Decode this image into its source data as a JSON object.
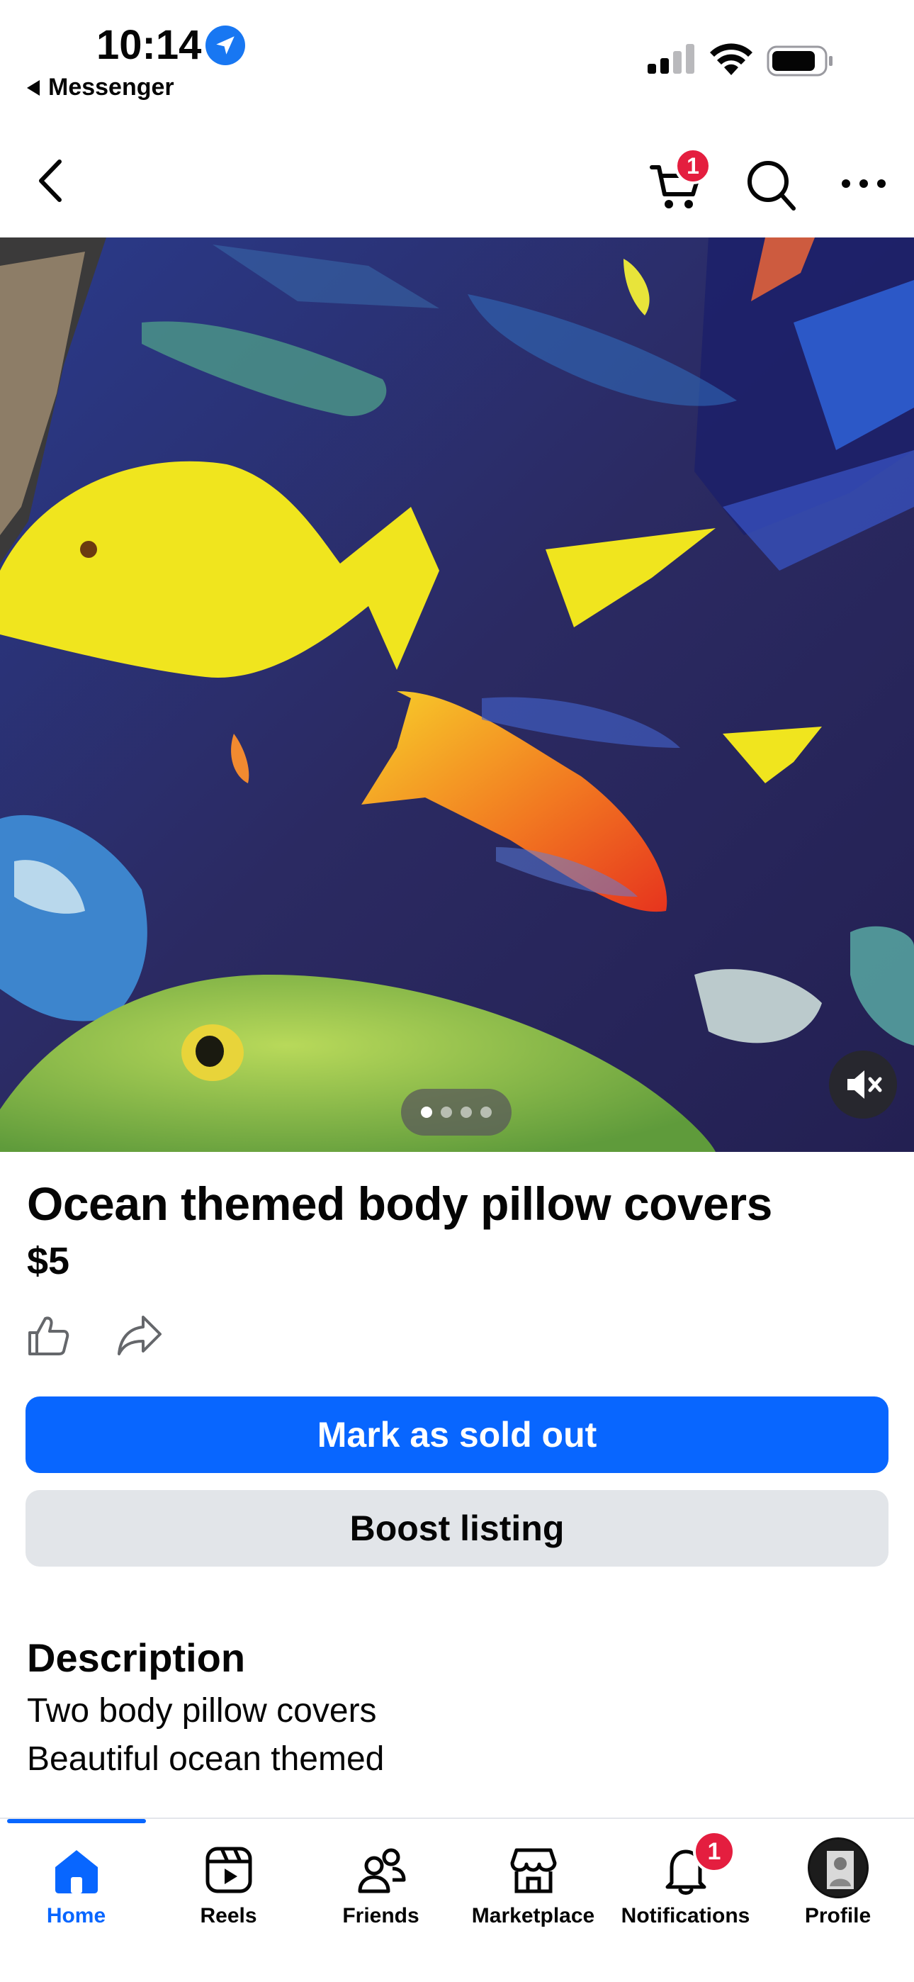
{
  "status_bar": {
    "time": "10:14",
    "back_app_label": "Messenger"
  },
  "header": {
    "cart_badge_count": "1",
    "icons": [
      "back-chevron-icon",
      "cart-icon",
      "search-icon",
      "more-icon"
    ]
  },
  "gallery": {
    "image_count": 4,
    "active_index": 0,
    "mute_icon": "speaker-muted-icon"
  },
  "listing": {
    "title": "Ocean themed body pillow covers",
    "price": "$5",
    "primary_button": "Mark as sold out",
    "secondary_button": "Boost listing",
    "description_heading": "Description",
    "description_lines": [
      "Two body pillow covers",
      "Beautiful ocean themed"
    ]
  },
  "tabbar": {
    "active_tab": "home",
    "tabs": [
      {
        "id": "home",
        "label": "Home",
        "icon": "home-icon"
      },
      {
        "id": "reels",
        "label": "Reels",
        "icon": "reels-icon"
      },
      {
        "id": "friends",
        "label": "Friends",
        "icon": "friends-icon"
      },
      {
        "id": "marketplace",
        "label": "Marketplace",
        "icon": "marketplace-icon"
      },
      {
        "id": "notifications",
        "label": "Notifications",
        "icon": "bell-icon",
        "badge": "1"
      },
      {
        "id": "profile",
        "label": "Profile",
        "icon": "avatar"
      }
    ]
  },
  "colors": {
    "accent": "#0866ff",
    "badge": "#e41e3f",
    "secondary_button_bg": "#e2e5e9",
    "text": "#050505"
  }
}
